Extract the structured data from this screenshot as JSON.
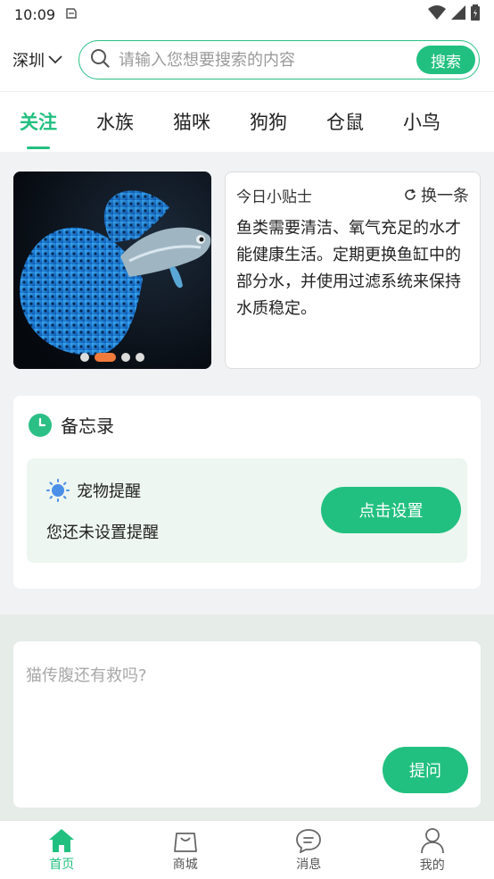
{
  "status": {
    "time": "10:09"
  },
  "header": {
    "city": "深圳",
    "search_placeholder": "请输入您想要搜索的内容",
    "search_button": "搜索"
  },
  "tabs": [
    {
      "label": "关注",
      "active": true
    },
    {
      "label": "水族"
    },
    {
      "label": "猫咪"
    },
    {
      "label": "狗狗"
    },
    {
      "label": "仓鼠"
    },
    {
      "label": "小鸟"
    }
  ],
  "banner": {
    "image": "blue-guppy-fish",
    "slides": 4,
    "active_slide": 1
  },
  "tip": {
    "title": "今日小贴士",
    "refresh_label": "换一条",
    "text": "鱼类需要清洁、氧气充足的水才能健康生活。定期更换鱼缸中的部分水，并使用过滤系统来保持水质稳定。"
  },
  "memo": {
    "title": "备忘录",
    "reminder_title": "宠物提醒",
    "reminder_status": "您还未设置提醒",
    "set_button": "点击设置"
  },
  "question": {
    "placeholder": "猫传腹还有救吗?",
    "ask_button": "提问"
  },
  "bottom_nav": [
    {
      "label": "首页",
      "icon": "home-icon",
      "active": true
    },
    {
      "label": "商城",
      "icon": "shopping-bag-icon"
    },
    {
      "label": "消息",
      "icon": "chat-bubble-icon"
    },
    {
      "label": "我的",
      "icon": "user-icon"
    }
  ],
  "colors": {
    "accent": "#22c080",
    "dot_active": "#f07a3a"
  }
}
